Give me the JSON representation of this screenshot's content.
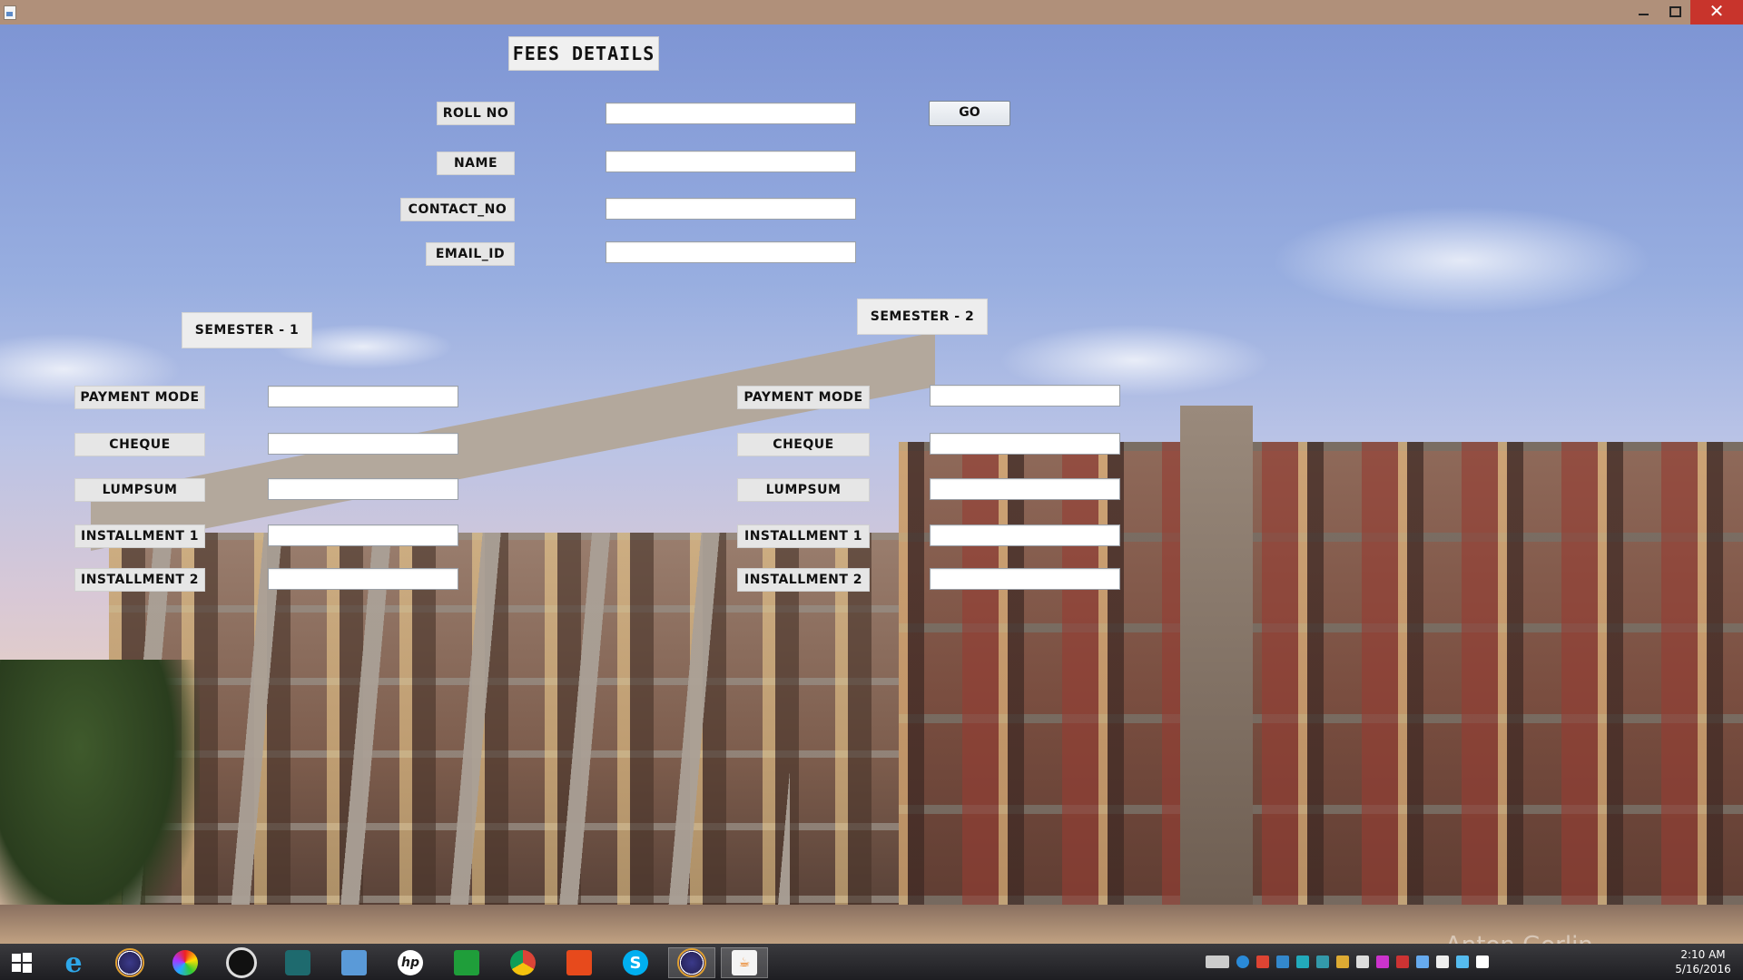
{
  "window": {
    "min_icon": "minimize-icon",
    "max_icon": "maximize-icon",
    "close_icon": "close-icon",
    "close_glyph": "✕"
  },
  "form": {
    "title": "FEES  DETAILS",
    "roll_no_label": "ROLL NO",
    "name_label": "NAME",
    "contact_label": "CONTACT_NO",
    "email_label": "EMAIL_ID",
    "go_button": "GO",
    "roll_no_value": "",
    "name_value": "",
    "contact_value": "",
    "email_value": ""
  },
  "semester1": {
    "heading": "SEMESTER - 1",
    "payment_mode_label": "PAYMENT MODE",
    "cheque_label": "CHEQUE",
    "lumpsum_label": "LUMPSUM",
    "installment1_label": "INSTALLMENT 1",
    "installment2_label": "INSTALLMENT 2",
    "payment_mode_value": "",
    "cheque_value": "",
    "lumpsum_value": "",
    "installment1_value": "",
    "installment2_value": ""
  },
  "semester2": {
    "heading": "SEMESTER - 2",
    "payment_mode_label": "PAYMENT MODE",
    "cheque_label": "CHEQUE",
    "lumpsum_label": "LUMPSUM",
    "installment1_label": "INSTALLMENT 1",
    "installment2_label": "INSTALLMENT 2",
    "payment_mode_value": "",
    "cheque_value": "",
    "lumpsum_value": "",
    "installment1_value": "",
    "installment2_value": ""
  },
  "background": {
    "watermark": "Anton Gorlin"
  },
  "taskbar": {
    "apps": [
      "windows-start-icon",
      "internet-explorer-icon",
      "eclipse-icon",
      "color-wheel-icon",
      "camera-icon",
      "video-camera-icon",
      "remote-desktop-icon",
      "hp-icon",
      "store-icon",
      "chrome-icon",
      "office-icon",
      "skype-icon",
      "eclipse-icon",
      "java-icon"
    ],
    "time": "2:10 AM",
    "date": "5/16/2016"
  }
}
